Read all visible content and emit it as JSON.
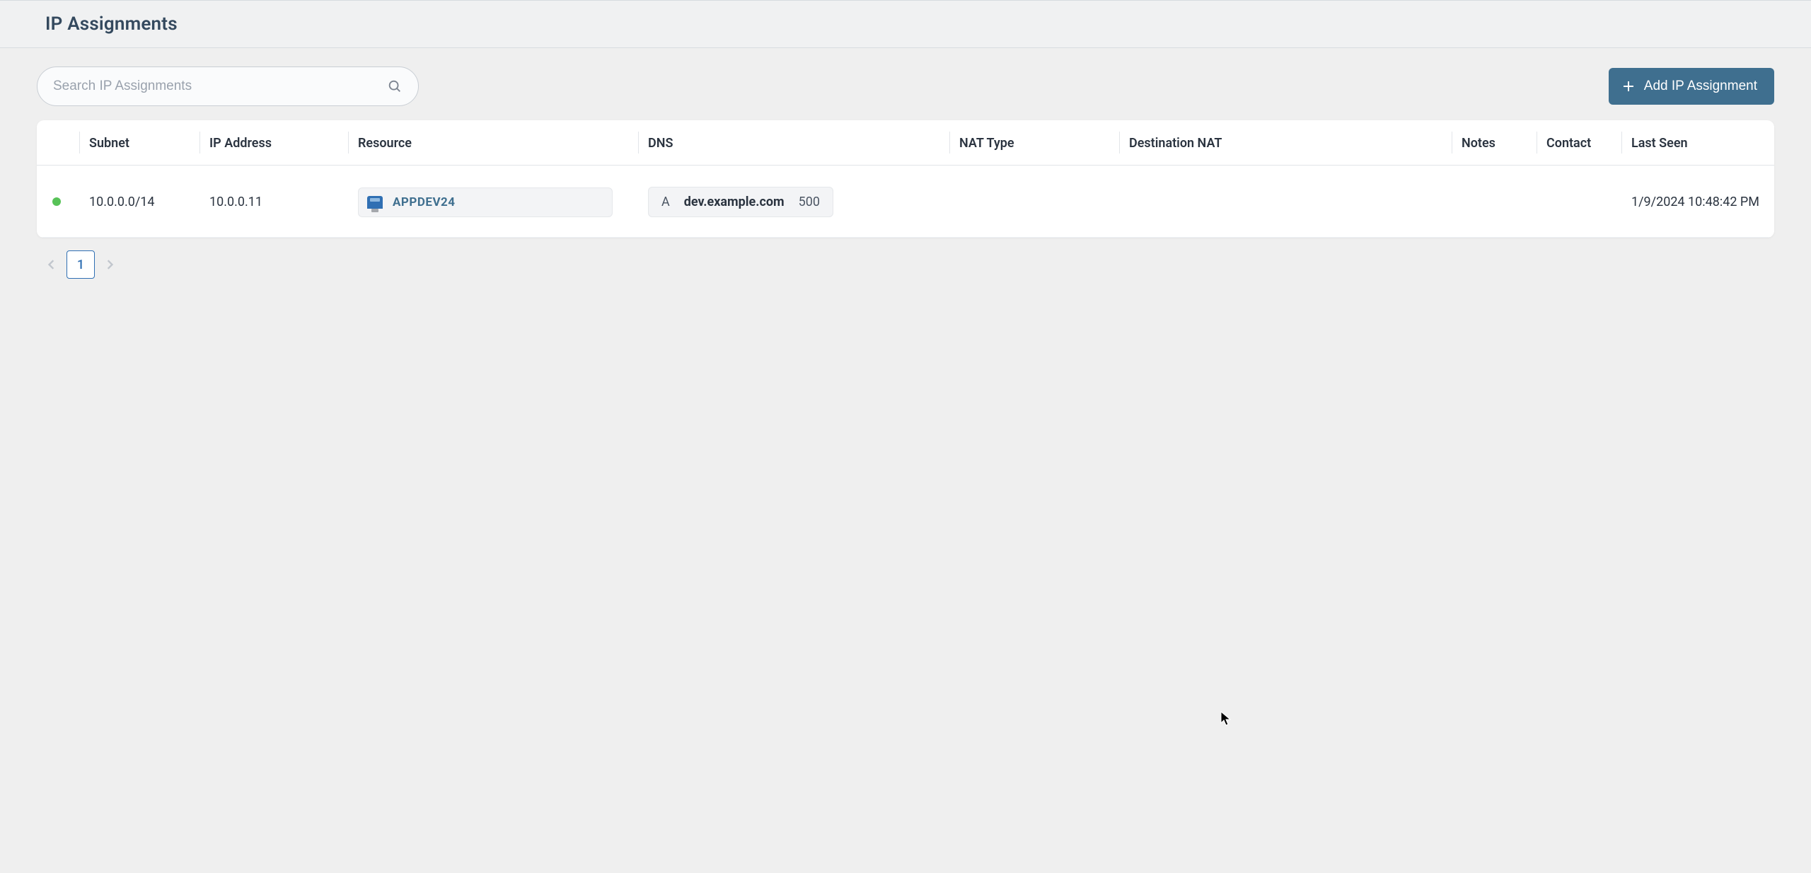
{
  "header": {
    "title": "IP Assignments"
  },
  "toolbar": {
    "search_placeholder": "Search IP Assignments",
    "add_button_label": "Add IP Assignment"
  },
  "table": {
    "columns": {
      "status": "",
      "subnet": "Subnet",
      "ip": "IP Address",
      "resource": "Resource",
      "dns": "DNS",
      "nat_type": "NAT Type",
      "dest_nat": "Destination NAT",
      "notes": "Notes",
      "contact": "Contact",
      "last_seen": "Last Seen"
    },
    "rows": [
      {
        "status": "online",
        "subnet": "10.0.0.0/14",
        "ip": "10.0.0.11",
        "resource": {
          "name": "APPDEV24",
          "icon": "monitor-icon"
        },
        "dns": {
          "type": "A",
          "host": "dev.example.com",
          "ttl": "500"
        },
        "nat_type": "",
        "dest_nat": "",
        "notes": "",
        "contact": "",
        "last_seen": "1/9/2024 10:48:42 PM"
      }
    ]
  },
  "pagination": {
    "current": "1"
  },
  "colors": {
    "accent": "#3f6f8f",
    "status_online": "#57c257"
  }
}
